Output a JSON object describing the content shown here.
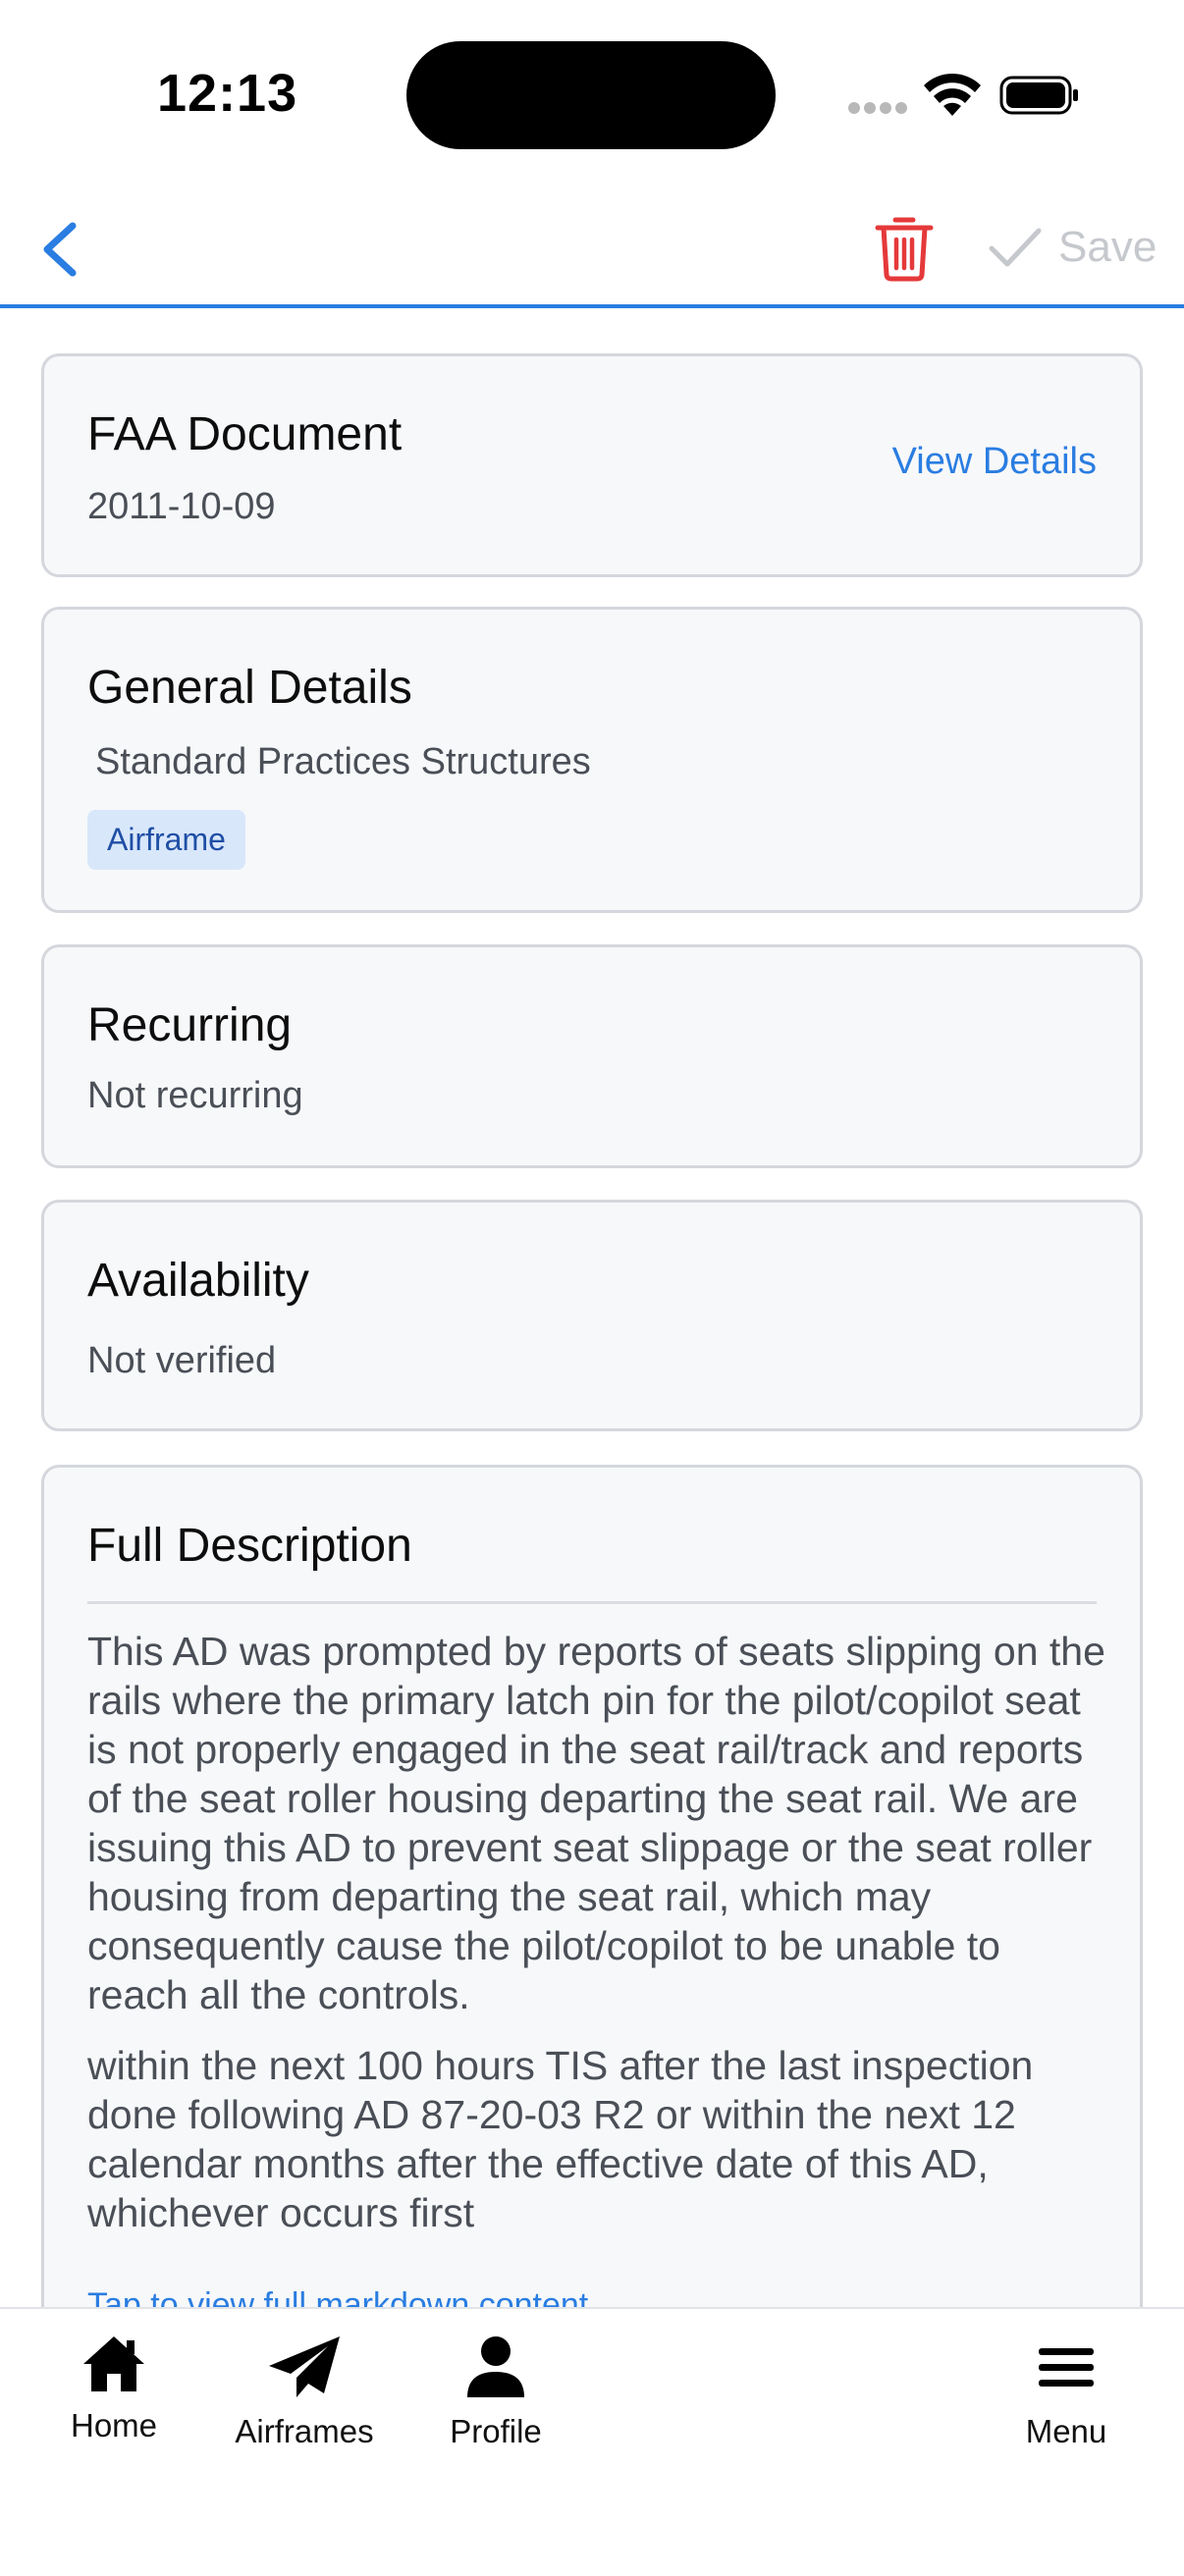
{
  "status_bar": {
    "time": "12:13"
  },
  "nav": {
    "save_label": "Save"
  },
  "faa_document": {
    "title": "FAA Document",
    "date": "2011-10-09",
    "link": "View Details"
  },
  "general_details": {
    "title": "General Details",
    "subtitle": "Standard Practices Structures",
    "badge": "Airframe"
  },
  "recurring": {
    "title": "Recurring",
    "value": "Not recurring"
  },
  "availability": {
    "title": "Availability",
    "value": "Not verified"
  },
  "full_description": {
    "title": "Full Description",
    "paragraph1": "This AD was prompted by reports of seats slipping on the rails where the primary latch pin for the pilot/copilot seat is not properly engaged in the seat rail/track and reports of the seat roller housing departing the seat rail. We are issuing this AD to prevent seat slippage or the seat roller housing from departing the seat rail, which may consequently cause the pilot/copilot to be unable to reach all the controls.",
    "paragraph2": "within the next 100 hours TIS after the last inspection done following AD 87-20-03 R2 or within the next 12 calendar months after the effective date of this AD, whichever occurs first",
    "tap_link": "Tap to view full markdown content"
  },
  "tabbar": {
    "home": "Home",
    "airframes": "Airframes",
    "profile": "Profile",
    "menu": "Menu"
  },
  "colors": {
    "accent": "#2a7de1",
    "danger": "#e5393a",
    "disabled": "#c5c8cd"
  }
}
